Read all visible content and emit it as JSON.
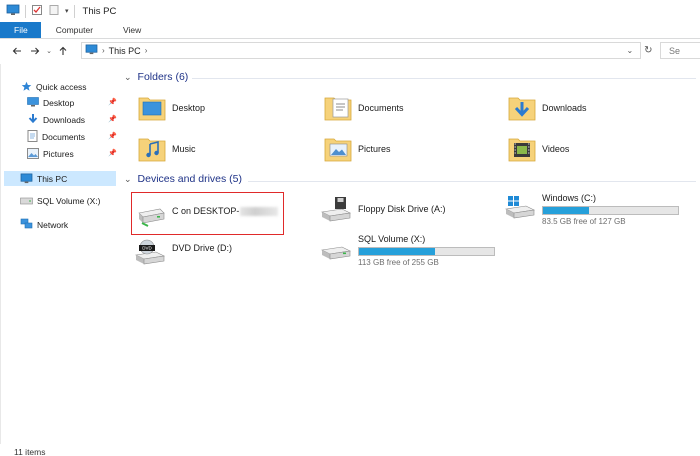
{
  "window": {
    "title": "This PC"
  },
  "ribbon": {
    "tabs": [
      "File",
      "Computer",
      "View"
    ]
  },
  "address": {
    "crumb": "This PC",
    "separator": "›"
  },
  "search": {
    "placeholder": "Se"
  },
  "navpane": {
    "quick_access": "Quick access",
    "items": [
      "Desktop",
      "Downloads",
      "Documents",
      "Pictures"
    ],
    "this_pc": "This PC",
    "sql_volume": "SQL Volume (X:)",
    "network": "Network"
  },
  "folders": {
    "header": "Folders (6)",
    "items": [
      "Desktop",
      "Documents",
      "Downloads",
      "Music",
      "Pictures",
      "Videos"
    ]
  },
  "drives": {
    "header": "Devices and drives (5)",
    "c_drive": {
      "name": "C on DESKTOP-"
    },
    "floppy": {
      "name": "Floppy Disk Drive (A:)"
    },
    "windows": {
      "name": "Windows (C:)",
      "size": "83.5 GB free of 127 GB",
      "used_fraction": 0.34
    },
    "dvd": {
      "name": "DVD Drive (D:)"
    },
    "sql": {
      "name": "SQL Volume (X:)",
      "size": "113 GB free of 255 GB",
      "used_fraction": 0.56
    }
  },
  "status": {
    "items": "11 items"
  },
  "colors": {
    "accent": "#1979ca",
    "selection": "#cce8ff",
    "usage_bar": "#26a0da",
    "highlight_box": "#e02a2a"
  }
}
